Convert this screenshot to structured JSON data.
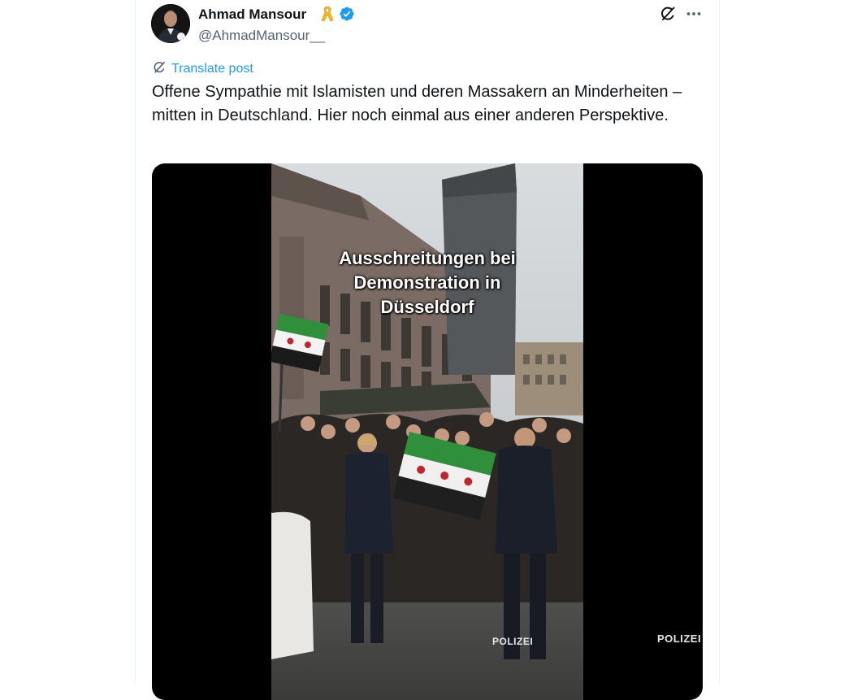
{
  "author": {
    "display_name": "Ahmad Mansour",
    "handle": "@AhmadMansour__",
    "ribbon_emoji": "yellow-ribbon",
    "verified": true,
    "verified_color": "#1d9bf0"
  },
  "actions": {
    "grok_icon": "grok-icon",
    "more_icon": "more-icon"
  },
  "post": {
    "translate_label": "Translate post",
    "text": "Offene Sympathie mit Islamisten und deren Massakern an Minderheiten – mitten in Deutschland. Hier noch einmal aus einer anderen Perspektive."
  },
  "video": {
    "caption": "Ausschreitungen bei\nDemonstration in\nDüsseldorf",
    "police_vest_1": "POLIZEI",
    "police_vest_2": "POLIZEI"
  },
  "colors": {
    "link": "#1d9bf0",
    "text": "#0f1419",
    "secondary": "#536471",
    "border": "#eff3f4"
  }
}
